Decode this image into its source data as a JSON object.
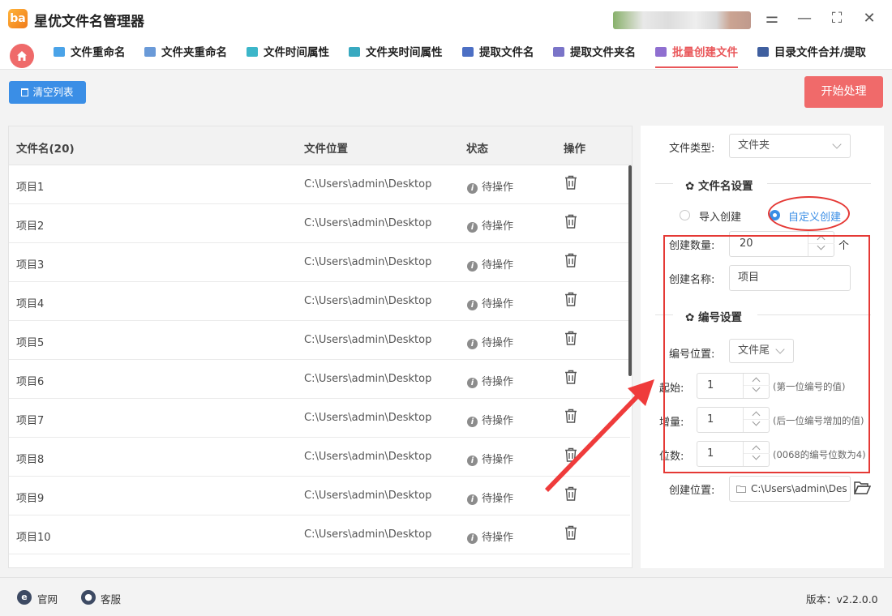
{
  "app": {
    "title": "星优文件名管理器",
    "logo_text": "ba"
  },
  "window_controls": {
    "settings": "⚌",
    "minimize": "—",
    "maximize": "⛶",
    "close": "✕"
  },
  "tabs": [
    {
      "label": "文件重命名",
      "icon_color": "#4aa3e8",
      "active": false
    },
    {
      "label": "文件夹重命名",
      "icon_color": "#6a9ad8",
      "active": false
    },
    {
      "label": "文件时间属性",
      "icon_color": "#3cb6c9",
      "active": false
    },
    {
      "label": "文件夹时间属性",
      "icon_color": "#38a9c0",
      "active": false
    },
    {
      "label": "提取文件名",
      "icon_color": "#4c6fc4",
      "active": false
    },
    {
      "label": "提取文件夹名",
      "icon_color": "#7a74c8",
      "active": false
    },
    {
      "label": "批量创建文件",
      "icon_color": "#8f6fd0",
      "active": true
    },
    {
      "label": "目录文件合并/提取",
      "icon_color": "#3f5f9f",
      "active": false
    }
  ],
  "toolbar": {
    "clear_label": "清空列表",
    "start_label": "开始处理"
  },
  "table": {
    "headers": {
      "name": "文件名(20)",
      "path": "文件位置",
      "status": "状态",
      "action": "操作"
    },
    "rows": [
      {
        "name": "项目1",
        "path": "C:\\Users\\admin\\Desktop",
        "status": "待操作"
      },
      {
        "name": "项目2",
        "path": "C:\\Users\\admin\\Desktop",
        "status": "待操作"
      },
      {
        "name": "项目3",
        "path": "C:\\Users\\admin\\Desktop",
        "status": "待操作"
      },
      {
        "name": "项目4",
        "path": "C:\\Users\\admin\\Desktop",
        "status": "待操作"
      },
      {
        "name": "项目5",
        "path": "C:\\Users\\admin\\Desktop",
        "status": "待操作"
      },
      {
        "name": "项目6",
        "path": "C:\\Users\\admin\\Desktop",
        "status": "待操作"
      },
      {
        "name": "项目7",
        "path": "C:\\Users\\admin\\Desktop",
        "status": "待操作"
      },
      {
        "name": "项目8",
        "path": "C:\\Users\\admin\\Desktop",
        "status": "待操作"
      },
      {
        "name": "项目9",
        "path": "C:\\Users\\admin\\Desktop",
        "status": "待操作"
      },
      {
        "name": "项目10",
        "path": "C:\\Users\\admin\\Desktop",
        "status": "待操作"
      }
    ]
  },
  "settings": {
    "file_type_label": "文件类型:",
    "file_type_value": "文件夹",
    "filename_section": "✿ 文件名设置",
    "radio_import": "导入创建",
    "radio_custom": "自定义创建",
    "count_label": "创建数量:",
    "count_value": "20",
    "count_unit": "个",
    "name_label": "创建名称:",
    "name_value": "项目",
    "number_section": "✿ 编号设置",
    "number_pos_label": "编号位置:",
    "number_pos_value": "文件尾",
    "start_label": "起始:",
    "start_value": "1",
    "start_hint": "(第一位编号的值)",
    "step_label": "增量:",
    "step_value": "1",
    "step_hint": "(后一位编号增加的值)",
    "digits_label": "位数:",
    "digits_value": "1",
    "digits_hint": "(0068的编号位数为4)",
    "location_label": "创建位置:",
    "location_value": "C:\\Users\\admin\\Des"
  },
  "statusbar": {
    "website": "官网",
    "support": "客服",
    "version": "版本：v2.2.0.0"
  },
  "colors": {
    "accent": "#3a8ee6",
    "brand_red": "#f06a6a",
    "annotation_red": "#e53935"
  }
}
